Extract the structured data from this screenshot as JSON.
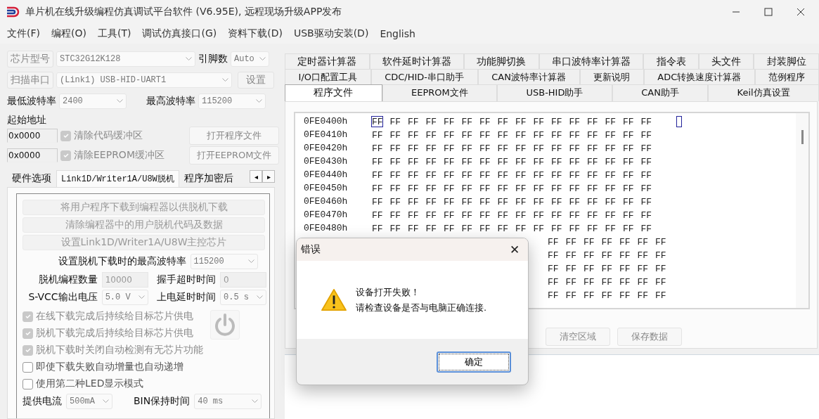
{
  "window": {
    "title": "单片机在线升级编程仿真调试平台软件 (V6.95E), 远程现场升级APP发布"
  },
  "menu": [
    "文件(F)",
    "编程(O)",
    "工具(T)",
    "调试仿真接口(G)",
    "资料下载(D)",
    "USB驱动安装(D)",
    "English"
  ],
  "left": {
    "chip": {
      "label": "芯片型号",
      "value": "STC32G12K128",
      "pins_label": "引脚数",
      "pins_value": "Auto"
    },
    "port": {
      "label": "扫描串口",
      "value": "(Link1) USB-HID-UART1",
      "settings": "设置"
    },
    "baud": {
      "min_label": "最低波特率",
      "min_value": "2400",
      "max_label": "最高波特率",
      "max_value": "115200"
    },
    "start_label": "起始地址",
    "files": [
      {
        "address": "0x0000",
        "checkbox": "清除代码缓冲区",
        "checked": true,
        "button": "打开程序文件"
      },
      {
        "address": "0x0000",
        "checkbox": "清除EEPROM缓冲区",
        "checked": true,
        "button": "打开EEPROM文件"
      }
    ],
    "tabs": [
      {
        "label": "硬件选项",
        "selected": false
      },
      {
        "label": "Link1D/Writer1A/U8W脱机",
        "selected": true
      },
      {
        "label": "程序加密后",
        "selected": false
      }
    ],
    "tab_scroll": [
      "◂",
      "▸"
    ],
    "actions": [
      "将用户程序下载到编程器以供脱机下载",
      "清除编程器中的用户脱机代码及数据",
      "设置Link1D/Writer1A/U8W主控芯片"
    ],
    "max_baud": {
      "label": "设置脱机下载时的最高波特率",
      "value": "115200"
    },
    "fields": [
      {
        "label": "脱机编程数量",
        "value": "10000",
        "kind": "input"
      },
      {
        "label": "握手超时时间",
        "value": "0",
        "kind": "input"
      },
      {
        "label": "S-VCC输出电压",
        "value": "5.0 V",
        "kind": "combo"
      },
      {
        "label": "上电延时时间",
        "value": "0.5 s",
        "kind": "combo"
      }
    ],
    "options": [
      {
        "label": "在线下载完成后持续给目标芯片供电",
        "checked": true,
        "disabled": true
      },
      {
        "label": "脱机下载完成后持续给目标芯片供电",
        "checked": true,
        "disabled": true
      },
      {
        "label": "脱机下载时关闭自动检测有无芯片功能",
        "checked": true,
        "disabled": true
      },
      {
        "label": "即使下载失败自动增量也自动递增",
        "checked": false,
        "disabled": false
      },
      {
        "label": "使用第二种LED显示模式",
        "checked": false,
        "disabled": false
      }
    ],
    "bottom": [
      {
        "label": "提供电流",
        "value": "500mA"
      },
      {
        "label": "BIN保持时间",
        "value": "40 ms"
      }
    ]
  },
  "right": {
    "tab_rows": [
      [
        {
          "label": "定时器计算器",
          "selected": false
        },
        {
          "label": "软件延时计算器",
          "selected": false
        },
        {
          "label": "功能脚切换",
          "selected": false
        },
        {
          "label": "串口波特率计算器",
          "selected": false
        },
        {
          "label": "指令表",
          "selected": false
        },
        {
          "label": "头文件",
          "selected": false
        },
        {
          "label": "封装脚位",
          "selected": false
        }
      ],
      [
        {
          "label": "I/O口配置工具",
          "selected": false
        },
        {
          "label": "CDC/HID-串口助手",
          "selected": false
        },
        {
          "label": "CAN波特率计算器",
          "selected": false
        },
        {
          "label": "更新说明",
          "selected": false
        },
        {
          "label": "ADC转换速度计算器",
          "selected": false
        },
        {
          "label": "范例程序",
          "selected": false
        }
      ],
      [
        {
          "label": "程序文件",
          "selected": true
        },
        {
          "label": "EEPROM文件",
          "selected": false
        },
        {
          "label": "USB-HID助手",
          "selected": false
        },
        {
          "label": "CAN助手",
          "selected": false
        },
        {
          "label": "Keil仿真设置",
          "selected": false
        }
      ]
    ],
    "hex_rows": [
      {
        "address": "0FE0400h",
        "bytes": "FF FF FF FF FF FF FF FF FF FF FF FF FF FF FF FF",
        "kind": "full",
        "cursor": true
      },
      {
        "address": "0FE0410h",
        "bytes": "FF FF FF FF FF FF FF FF FF FF FF FF FF FF FF FF",
        "kind": "full"
      },
      {
        "address": "0FE0420h",
        "bytes": "FF FF FF FF FF FF FF FF FF FF FF FF FF FF FF FF",
        "kind": "full"
      },
      {
        "address": "0FE0430h",
        "bytes": "FF FF FF FF FF FF FF FF FF FF FF FF FF FF FF FF",
        "kind": "full"
      },
      {
        "address": "0FE0440h",
        "bytes": "FF FF FF FF FF FF FF FF FF FF FF FF FF FF FF FF",
        "kind": "full"
      },
      {
        "address": "0FE0450h",
        "bytes": "FF FF FF FF FF FF FF FF FF FF FF FF FF FF FF FF",
        "kind": "full"
      },
      {
        "address": "0FE0460h",
        "bytes": "FF FF FF FF FF FF FF FF FF FF FF FF FF FF FF FF",
        "kind": "full"
      },
      {
        "address": "0FE0470h",
        "bytes": "FF FF FF FF FF FF FF FF FF FF FF FF FF FF FF FF",
        "kind": "full"
      },
      {
        "address": "0FE0480h",
        "bytes": "FF FF FF FF FF FF FF FF FF FF FF FF FF FF FF FF",
        "kind": "full"
      },
      {
        "bytes": "FF FF FF FF FF FF FF",
        "kind": "partial"
      },
      {
        "bytes": "FF FF FF FF FF FF FF",
        "kind": "partial"
      },
      {
        "bytes": "FF FF FF FF FF FF FF",
        "kind": "partial"
      },
      {
        "bytes": "FF FF FF FF FF FF FF",
        "kind": "partial"
      },
      {
        "bytes": "FF FF FF FF FF FF FF",
        "kind": "partial"
      }
    ],
    "buttons": [
      "清空区域",
      "保存数据"
    ]
  },
  "dialog": {
    "title": "错误",
    "close": "✕",
    "lines": [
      "设备打开失败！",
      "请检查设备是否与电脑正确连接."
    ],
    "ok": "确定"
  }
}
